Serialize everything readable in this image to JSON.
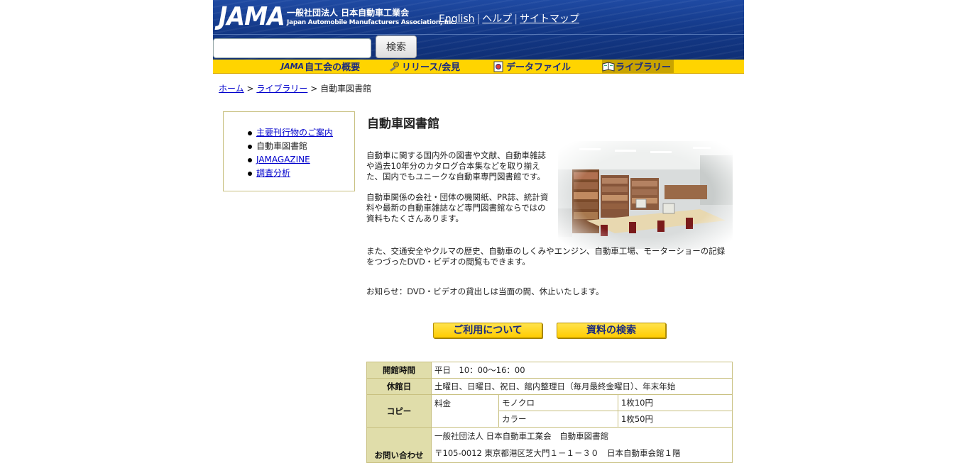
{
  "header": {
    "logo_mark": "JAMA",
    "org_name_jp": "一般社団法人  日本自動車工業会",
    "org_name_en": "Japan Automobile Manufacturers Association, Inc.",
    "links": [
      "English",
      "ヘルプ",
      "サイトマップ"
    ],
    "search": {
      "placeholder": "",
      "value": "",
      "button_label": "検索"
    }
  },
  "nav": {
    "items": [
      {
        "prefix": "JAMA",
        "label": "自工会の概要",
        "icon": "jama-logo-icon"
      },
      {
        "label": "リリース/会見",
        "icon": "microphone-icon"
      },
      {
        "label": "データファイル",
        "icon": "document-icon"
      },
      {
        "label": "ライブラリー",
        "icon": "book-icon",
        "active": true
      }
    ]
  },
  "breadcrumb": {
    "home": "ホーム",
    "sep1": ">",
    "library": "ライブラリー",
    "sep2": ">",
    "current": "自動車図書館"
  },
  "sidebar": {
    "items": [
      {
        "label": "主要刊行物のご案内",
        "link": true
      },
      {
        "label": "自動車図書館",
        "link": false
      },
      {
        "label": "JAMAGAZINE",
        "link": true
      },
      {
        "label": "調査分析",
        "link": true
      }
    ]
  },
  "main": {
    "title": "自動車図書館",
    "para1": "自動車に関する国内外の図書や文献、自動車雑誌や過去10年分のカタログ合本集などを取り揃えた、国内でもユニークな自動車専門図書館です。",
    "para2": "自動車関係の会社・団体の機関紙、PR誌、統計資料や最新の自動車雑誌など専門図書館ならではの資料もたくさんあります。",
    "para3": "また、交通安全やクルマの歴史、自動車のしくみやエンジン、自動車工場、モーターショーの記録をつづったDVD・ビデオの閲覧もできます。",
    "notice": "お知らせ：DVD・ビデオの貸出しは当面の間、休止いたします。",
    "buttons": {
      "usage": "ご利用について",
      "search": "資料の検索"
    }
  },
  "info_table": {
    "hours_label": "開館時間",
    "hours_value": "平日　10：00〜16：00",
    "closed_label": "休館日",
    "closed_value": "土曜日、日曜日、祝日、館内整理日（毎月最終金曜日）、年末年始",
    "copy_label": "コピー",
    "copy_fee_label": "料金",
    "copy_mono_label": "モノクロ",
    "copy_mono_price": "1枚10円",
    "copy_color_label": "カラー",
    "copy_color_price": "1枚50円",
    "contact_label": "お問い合わせ",
    "contact_line1": "一般社団法人 日本自動車工業会　自動車図書館",
    "contact_line2": "〒105-0012 東京都港区芝大門１－１－３０　日本自動車会館１階"
  }
}
